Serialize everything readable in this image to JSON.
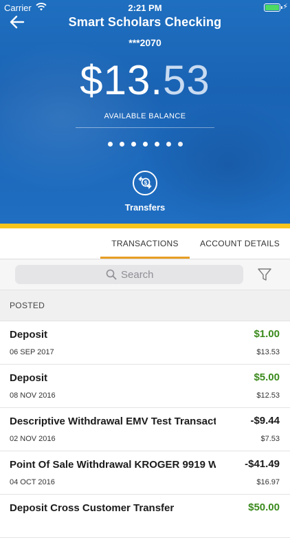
{
  "status_bar": {
    "carrier": "Carrier",
    "time": "2:21 PM"
  },
  "header": {
    "title": "Smart Scholars Checking",
    "account_number": "***2070",
    "balance_main": "$13.",
    "balance_cents": "53",
    "balance_label": "AVAILABLE BALANCE",
    "pager_count": 7,
    "transfers_label": "Transfers"
  },
  "colors": {
    "hero_blue": "#1a63b4",
    "accent_yellow": "#f7c51c",
    "tab_underline": "#e89d23",
    "positive_green": "#3a8a1c",
    "negative": "#1b1b1b"
  },
  "tabs": [
    {
      "label": "TRANSACTIONS",
      "active": true
    },
    {
      "label": "ACCOUNT DETAILS",
      "active": false
    }
  ],
  "search": {
    "placeholder": "Search"
  },
  "section": {
    "label": "POSTED"
  },
  "transactions": [
    {
      "description": "Deposit",
      "date": "06 SEP 2017",
      "amount": "$1.00",
      "balance": "$13.53",
      "positive": true
    },
    {
      "description": "Deposit",
      "date": "08 NOV 2016",
      "amount": "$5.00",
      "balance": "$12.53",
      "positive": true
    },
    {
      "description": "Descriptive Withdrawal EMV Test Transact...",
      "date": "02 NOV 2016",
      "amount": "-$9.44",
      "balance": "$7.53",
      "positive": false
    },
    {
      "description": "Point Of Sale Withdrawal KROGER 9919 W...",
      "date": "04 OCT 2016",
      "amount": "-$41.49",
      "balance": "$16.97",
      "positive": false
    },
    {
      "description": "Deposit Cross Customer Transfer",
      "date": "",
      "amount": "$50.00",
      "balance": "",
      "positive": true
    }
  ]
}
